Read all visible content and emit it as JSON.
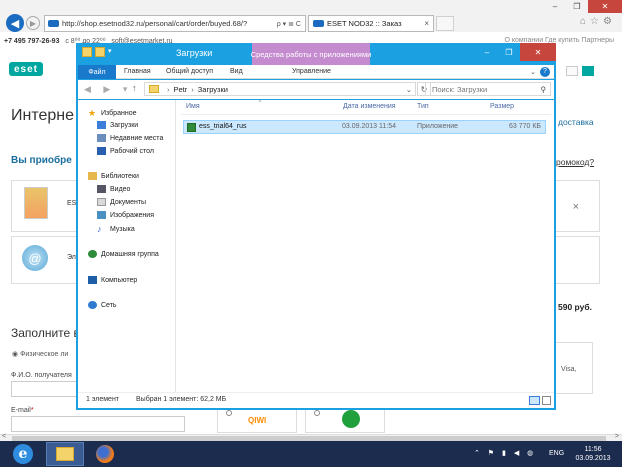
{
  "browser": {
    "window_controls": [
      "–",
      "❐",
      "✕"
    ],
    "address_url": "http://shop.esetnod32.ru/personal/cart/order/buyed.68/?",
    "address_tools": "ρ ▾ ≣ C",
    "tab_title": "ESET NOD32 :: Заказ",
    "tab_close": "×",
    "back_icon": "◀",
    "forward_icon": "▶",
    "toolbar_icons": "⌂☆⚙"
  },
  "site": {
    "phone": "+7 495 797-26-93",
    "hours": "с 8⁰⁰ до 22⁰⁰",
    "email": "soft@esetmarket.ru",
    "top_links": "О компании    Где купить    Партнеры",
    "logo": "eset",
    "heading": "Интерне",
    "subheading": "Вы приобре",
    "delivery": "доставка",
    "promo": "ромокод?",
    "product_text": "ES",
    "product_close": "×",
    "mail_text": "Эл",
    "price": "590 руб.",
    "form_heading": "Заполните в",
    "radio_label": "Физическое ли",
    "fio_label": "Ф.И.О. получателя",
    "email_label": "E-mail",
    "email_required": "*",
    "visa_text": "Visa,",
    "qiwi_text": "QIWI"
  },
  "explorer": {
    "title": "Загрузки",
    "context_tab": "Средства работы с приложениями",
    "window_controls": [
      "–",
      "❐",
      "✕"
    ],
    "ribbon": {
      "file": "Файл",
      "home": "Главная",
      "share": "Общий доступ",
      "view": "Вид",
      "manage": "Управление",
      "expand_icon": "⌄",
      "help_icon": "?"
    },
    "nav_arrows": "◀ ▶ ▾",
    "up_icon": "↑",
    "breadcrumb": [
      "Petr",
      "Загрузки"
    ],
    "breadcrumb_sep": "›",
    "breadcrumb_dd": "⌄",
    "refresh_icon": "↻",
    "search_placeholder": "Поиск: Загрузки",
    "search_icon": "⚲",
    "nav": {
      "favorites": "Избранное",
      "downloads": "Загрузки",
      "recent": "Недавние места",
      "desktop": "Рабочий стол",
      "libraries": "Библиотеки",
      "video": "Видео",
      "documents": "Документы",
      "images": "Изображения",
      "music": "Музыка",
      "homegroup": "Домашняя группа",
      "computer": "Компьютер",
      "network": "Сеть"
    },
    "columns": {
      "name": "Имя",
      "date": "Дата изменения",
      "type": "Тип",
      "size": "Размер"
    },
    "sort_caret": "^",
    "files": [
      {
        "name": "ess_trial64_rus",
        "date": "03.09.2013 11:54",
        "type": "Приложение",
        "size": "63 770 КБ"
      }
    ],
    "status": {
      "count": "1 элемент",
      "selected": "Выбран 1 элемент: 62,2 МБ"
    }
  },
  "taskbar": {
    "ie_label": "e",
    "tray_icons": "⌃ ⚑ ▮ ◀ ◍",
    "lang": "ENG",
    "time": "11:56",
    "date": "03.09.2013"
  },
  "scroll": {
    "left_arrow": "<",
    "right_arrow": ">"
  }
}
